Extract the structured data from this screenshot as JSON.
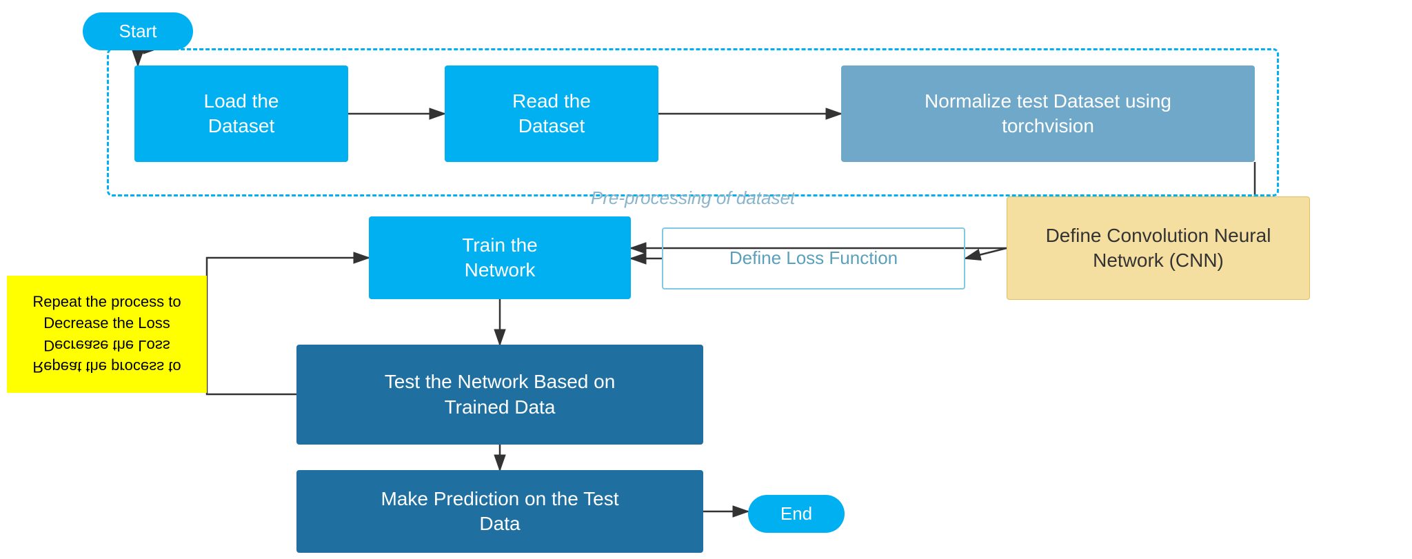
{
  "start": {
    "label": "Start"
  },
  "end": {
    "label": "End"
  },
  "preproc_label": "Pre-processing of dataset",
  "load": {
    "label": "Load the\nDataset"
  },
  "read": {
    "label": "Read the\nDataset"
  },
  "normalize": {
    "label": "Normalize test Dataset using\ntorchvision"
  },
  "train": {
    "label": "Train the\nNetwork"
  },
  "loss": {
    "label": "Define Loss Function"
  },
  "cnn": {
    "label": "Define Convolution Neural\nNetwork (CNN)"
  },
  "test": {
    "label": "Test the Network Based on\nTrained Data"
  },
  "predict": {
    "label": "Make Prediction on the Test\nData"
  },
  "repeat": {
    "label": "Repeat the process to\nDecrease the Loss\nDecrease the Loss\nRepeat the process to"
  }
}
